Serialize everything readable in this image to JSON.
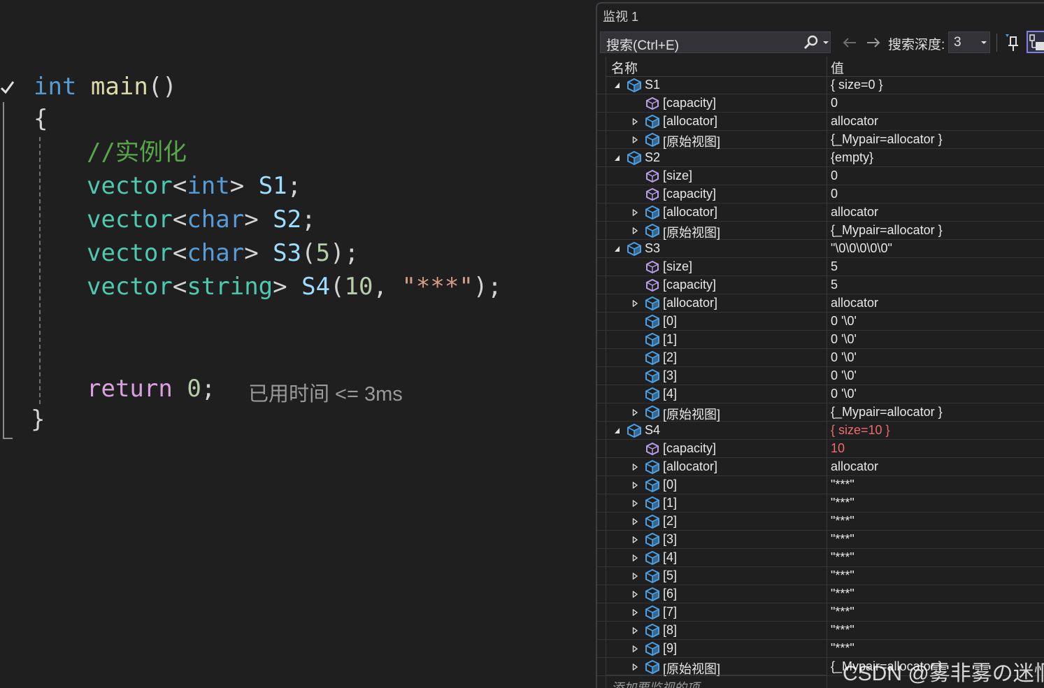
{
  "editor": {
    "lines": [
      {
        "tokens": [
          {
            "t": "int",
            "c": "kw"
          },
          {
            "t": " ",
            "c": "pn"
          },
          {
            "t": "main",
            "c": "fn"
          },
          {
            "t": "()",
            "c": "pn"
          }
        ]
      },
      {
        "tokens": [
          {
            "t": "{",
            "c": "pn"
          }
        ]
      },
      {
        "tokens": [
          {
            "t": "//实例化",
            "c": "cm"
          }
        ]
      },
      {
        "tokens": [
          {
            "t": "vector",
            "c": "ty"
          },
          {
            "t": "<",
            "c": "pn"
          },
          {
            "t": "int",
            "c": "kw"
          },
          {
            "t": ">",
            "c": "pn"
          },
          {
            "t": " ",
            "c": "pn"
          },
          {
            "t": "S1",
            "c": "va"
          },
          {
            "t": ";",
            "c": "pn"
          }
        ]
      },
      {
        "tokens": [
          {
            "t": "vector",
            "c": "ty"
          },
          {
            "t": "<",
            "c": "pn"
          },
          {
            "t": "char",
            "c": "kw"
          },
          {
            "t": ">",
            "c": "pn"
          },
          {
            "t": " ",
            "c": "pn"
          },
          {
            "t": "S2",
            "c": "va"
          },
          {
            "t": ";",
            "c": "pn"
          }
        ]
      },
      {
        "tokens": [
          {
            "t": "vector",
            "c": "ty"
          },
          {
            "t": "<",
            "c": "pn"
          },
          {
            "t": "char",
            "c": "kw"
          },
          {
            "t": ">",
            "c": "pn"
          },
          {
            "t": " ",
            "c": "pn"
          },
          {
            "t": "S3",
            "c": "va"
          },
          {
            "t": "(",
            "c": "pn"
          },
          {
            "t": "5",
            "c": "nu"
          },
          {
            "t": ");",
            "c": "pn"
          }
        ]
      },
      {
        "tokens": [
          {
            "t": "vector",
            "c": "ty"
          },
          {
            "t": "<",
            "c": "pn"
          },
          {
            "t": "string",
            "c": "ty"
          },
          {
            "t": ">",
            "c": "pn"
          },
          {
            "t": " ",
            "c": "pn"
          },
          {
            "t": "S4",
            "c": "va"
          },
          {
            "t": "(",
            "c": "pn"
          },
          {
            "t": "10",
            "c": "nu"
          },
          {
            "t": ", ",
            "c": "pn"
          },
          {
            "t": "\"***\"",
            "c": "st"
          },
          {
            "t": ");",
            "c": "pn"
          }
        ]
      },
      {
        "tokens": [
          {
            "t": "return",
            "c": "rk"
          },
          {
            "t": " ",
            "c": "pn"
          },
          {
            "t": "0",
            "c": "nu"
          },
          {
            "t": ";",
            "c": "pn"
          }
        ]
      },
      {
        "tokens": [
          {
            "t": "}",
            "c": "pn"
          }
        ]
      }
    ],
    "elapsed": "已用时间 <= 3ms"
  },
  "watch": {
    "title": "监视 1",
    "search_placeholder": "搜索(Ctrl+E)",
    "depth_label": "搜索深度:",
    "depth_value": "3",
    "col_name": "名称",
    "col_value": "值",
    "add_item": "添加要监视的项",
    "rows": [
      {
        "level": 0,
        "exp": "expanded",
        "icon": "object",
        "name": "S1",
        "value": "{ size=0 }"
      },
      {
        "level": 1,
        "exp": "none",
        "icon": "member",
        "name": "[capacity]",
        "value": "0"
      },
      {
        "level": 1,
        "exp": "collapsed",
        "icon": "object",
        "name": "[allocator]",
        "value": "allocator"
      },
      {
        "level": 1,
        "exp": "collapsed",
        "icon": "object",
        "name": "[原始视图]",
        "value": "{_Mypair=allocator }"
      },
      {
        "level": 0,
        "exp": "expanded",
        "icon": "object",
        "name": "S2",
        "value": "{empty}"
      },
      {
        "level": 1,
        "exp": "none",
        "icon": "member",
        "name": "[size]",
        "value": "0"
      },
      {
        "level": 1,
        "exp": "none",
        "icon": "member",
        "name": "[capacity]",
        "value": "0"
      },
      {
        "level": 1,
        "exp": "collapsed",
        "icon": "object",
        "name": "[allocator]",
        "value": "allocator"
      },
      {
        "level": 1,
        "exp": "collapsed",
        "icon": "object",
        "name": "[原始视图]",
        "value": "{_Mypair=allocator }"
      },
      {
        "level": 0,
        "exp": "expanded",
        "icon": "object",
        "name": "S3",
        "value": "\"\\0\\0\\0\\0\\0\""
      },
      {
        "level": 1,
        "exp": "none",
        "icon": "member",
        "name": "[size]",
        "value": "5"
      },
      {
        "level": 1,
        "exp": "none",
        "icon": "member",
        "name": "[capacity]",
        "value": "5"
      },
      {
        "level": 1,
        "exp": "collapsed",
        "icon": "object",
        "name": "[allocator]",
        "value": "allocator"
      },
      {
        "level": 1,
        "exp": "none",
        "icon": "object",
        "name": "[0]",
        "value": "0 '\\0'"
      },
      {
        "level": 1,
        "exp": "none",
        "icon": "object",
        "name": "[1]",
        "value": "0 '\\0'"
      },
      {
        "level": 1,
        "exp": "none",
        "icon": "object",
        "name": "[2]",
        "value": "0 '\\0'"
      },
      {
        "level": 1,
        "exp": "none",
        "icon": "object",
        "name": "[3]",
        "value": "0 '\\0'"
      },
      {
        "level": 1,
        "exp": "none",
        "icon": "object",
        "name": "[4]",
        "value": "0 '\\0'"
      },
      {
        "level": 1,
        "exp": "collapsed",
        "icon": "object",
        "name": "[原始视图]",
        "value": "{_Mypair=allocator }"
      },
      {
        "level": 0,
        "exp": "expanded",
        "icon": "object",
        "name": "S4",
        "value": "{ size=10 }",
        "changed": true
      },
      {
        "level": 1,
        "exp": "none",
        "icon": "member",
        "name": "[capacity]",
        "value": "10",
        "changed": true
      },
      {
        "level": 1,
        "exp": "collapsed",
        "icon": "object",
        "name": "[allocator]",
        "value": "allocator"
      },
      {
        "level": 1,
        "exp": "collapsed",
        "icon": "object",
        "name": "[0]",
        "value": "\"***\""
      },
      {
        "level": 1,
        "exp": "collapsed",
        "icon": "object",
        "name": "[1]",
        "value": "\"***\""
      },
      {
        "level": 1,
        "exp": "collapsed",
        "icon": "object",
        "name": "[2]",
        "value": "\"***\""
      },
      {
        "level": 1,
        "exp": "collapsed",
        "icon": "object",
        "name": "[3]",
        "value": "\"***\""
      },
      {
        "level": 1,
        "exp": "collapsed",
        "icon": "object",
        "name": "[4]",
        "value": "\"***\""
      },
      {
        "level": 1,
        "exp": "collapsed",
        "icon": "object",
        "name": "[5]",
        "value": "\"***\""
      },
      {
        "level": 1,
        "exp": "collapsed",
        "icon": "object",
        "name": "[6]",
        "value": "\"***\""
      },
      {
        "level": 1,
        "exp": "collapsed",
        "icon": "object",
        "name": "[7]",
        "value": "\"***\""
      },
      {
        "level": 1,
        "exp": "collapsed",
        "icon": "object",
        "name": "[8]",
        "value": "\"***\""
      },
      {
        "level": 1,
        "exp": "collapsed",
        "icon": "object",
        "name": "[9]",
        "value": "\"***\""
      },
      {
        "level": 1,
        "exp": "collapsed",
        "icon": "object",
        "name": "[原始视图]",
        "value": "{_Mypair=allocator }"
      }
    ]
  },
  "watermark": "CSDN @雾非雾の迷惘",
  "colors": {
    "changed_value": "#f0696b",
    "object_icon": "#4aa0e6",
    "member_icon": "#b89ee8"
  }
}
